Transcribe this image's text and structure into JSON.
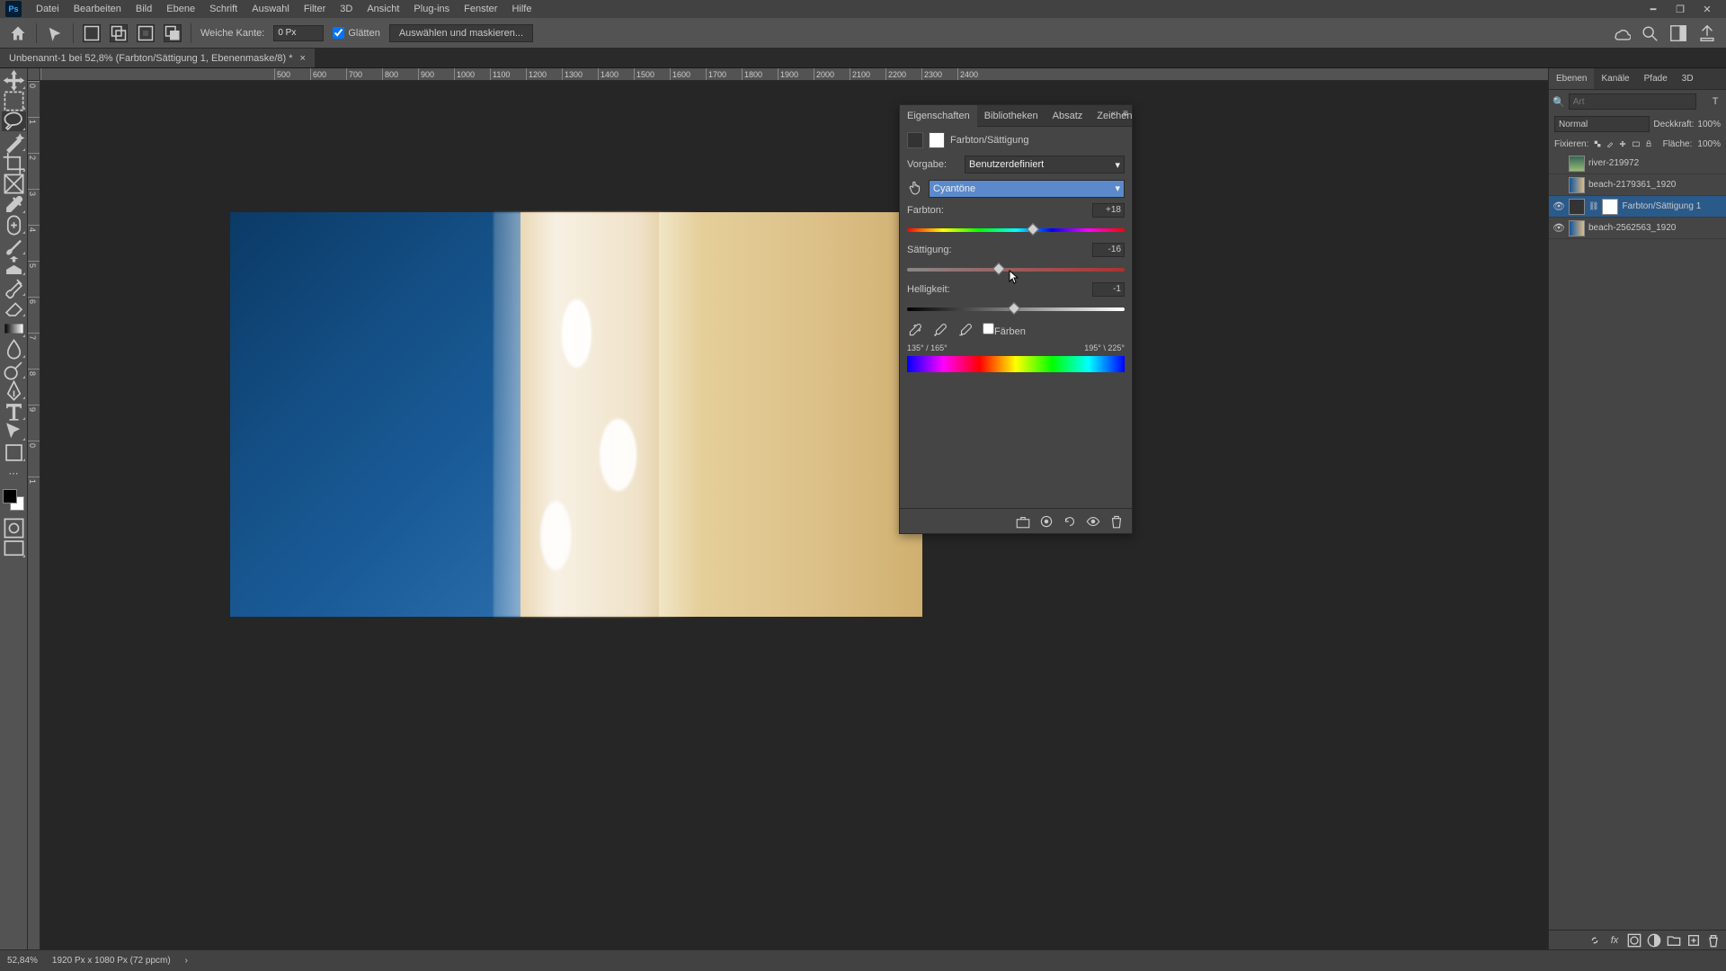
{
  "menu": {
    "items": [
      "Datei",
      "Bearbeiten",
      "Bild",
      "Ebene",
      "Schrift",
      "Auswahl",
      "Filter",
      "3D",
      "Ansicht",
      "Plug-ins",
      "Fenster",
      "Hilfe"
    ]
  },
  "optbar": {
    "feather_label": "Weiche Kante:",
    "feather_value": "0 Px",
    "antialias": "Glätten",
    "select_mask": "Auswählen und maskieren..."
  },
  "doctab": {
    "title": "Unbenannt-1 bei 52,8% (Farbton/Sättigung 1, Ebenenmaske/8) *"
  },
  "ruler_h": [
    "",
    "500",
    "600",
    "700",
    "800",
    "900",
    "1000",
    "1100",
    "1200",
    "1300",
    "1400",
    "1500",
    "1600",
    "1700",
    "1800",
    "1900",
    "2000",
    "2100",
    "2200",
    "2300",
    "2400"
  ],
  "ruler_v": [
    "0",
    "1",
    "2",
    "3",
    "4",
    "5",
    "6",
    "7",
    "8",
    "9",
    "0",
    "1"
  ],
  "props": {
    "tabs": {
      "eigenschaften": "Eigenschaften",
      "bibliotheken": "Bibliotheken",
      "absatz": "Absatz",
      "zeichen": "Zeichen"
    },
    "title": "Farbton/Sättigung",
    "preset_label": "Vorgabe:",
    "preset_value": "Benutzerdefiniert",
    "channel_value": "Cyantöne",
    "hue_label": "Farbton:",
    "hue_value": "+18",
    "sat_label": "Sättigung:",
    "sat_value": "-16",
    "lig_label": "Helligkeit:",
    "lig_value": "-1",
    "colorize": "Färben",
    "range_left": "135° / 165°",
    "range_right": "195° \\ 225°"
  },
  "layerspanel": {
    "tabs": {
      "ebenen": "Ebenen",
      "kanale": "Kanäle",
      "pfade": "Pfade",
      "d3": "3D"
    },
    "search_placeholder": "Art",
    "blend": "Normal",
    "opacity_label": "Deckkraft:",
    "opacity_value": "100%",
    "lock_label": "Fixieren:",
    "fill_label": "Fläche:",
    "fill_value": "100%",
    "layers": [
      {
        "name": "river-219972"
      },
      {
        "name": "beach-2179361_1920"
      },
      {
        "name": "Farbton/Sättigung 1"
      },
      {
        "name": "beach-2562563_1920"
      }
    ]
  },
  "status": {
    "zoom": "52,84%",
    "docinfo": "1920 Px x 1080 Px (72 ppcm)"
  }
}
